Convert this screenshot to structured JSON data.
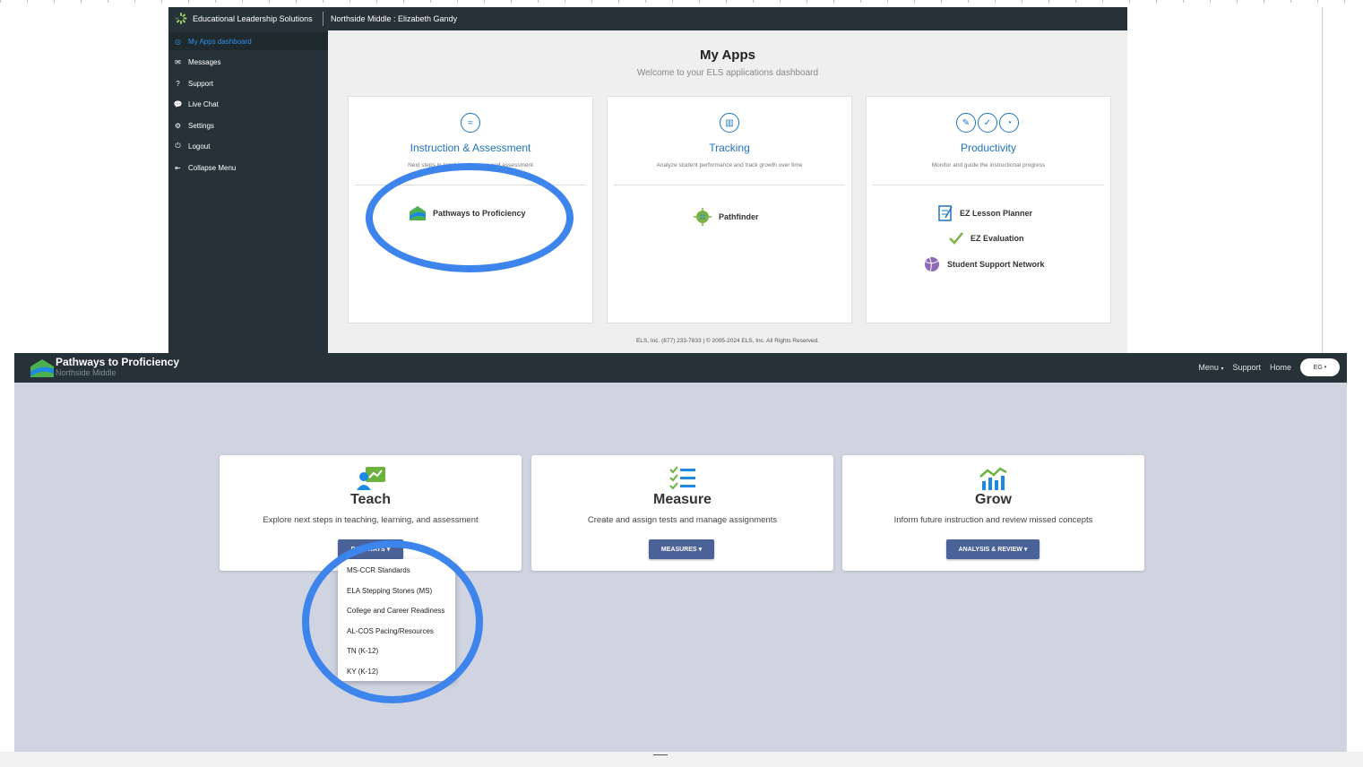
{
  "els": {
    "brand": "Educational Leadership Solutions",
    "school_user": "Northside Middle : Elizabeth Gandy",
    "sidebar": [
      {
        "label": "My Apps dashboard",
        "icon": "dashboard-icon",
        "glyph": "◎"
      },
      {
        "label": "Messages",
        "icon": "envelope-icon",
        "glyph": "✉"
      },
      {
        "label": "Support",
        "icon": "question-icon",
        "glyph": "?"
      },
      {
        "label": "Live Chat",
        "icon": "chat-icon",
        "glyph": "💬"
      },
      {
        "label": "Settings",
        "icon": "gear-icon",
        "glyph": "⚙"
      },
      {
        "label": "Logout",
        "icon": "logout-icon",
        "glyph": "⏻"
      },
      {
        "label": "Collapse Menu",
        "icon": "collapse-icon",
        "glyph": "⇤"
      }
    ],
    "title": "My Apps",
    "subtitle": "Welcome to your ELS applications dashboard",
    "cards": [
      {
        "title": "Instruction & Assessment",
        "desc": "Next steps in teaching, learning and assessment",
        "apps": [
          "Pathways to Proficiency"
        ]
      },
      {
        "title": "Tracking",
        "desc": "Analyze student performance and track growth over time",
        "apps": [
          "Pathfinder"
        ]
      },
      {
        "title": "Productivity",
        "desc": "Monitor and guide the instructional progress",
        "apps": [
          "EZ Lesson Planner",
          "EZ Evaluation",
          "Student Support Network"
        ]
      }
    ],
    "footer": "ELS, Inc. (877) 233-7833 | © 2005-2024 ELS, Inc. All Rights Reserved."
  },
  "ptp": {
    "title": "Pathways to Proficiency",
    "school": "Northside Middle",
    "nav": {
      "menu": "Menu",
      "support": "Support",
      "home": "Home",
      "user": "EG"
    },
    "cards": [
      {
        "title": "Teach",
        "desc": "Explore next steps in teaching, learning, and assessment",
        "button": "PATHWAYS"
      },
      {
        "title": "Measure",
        "desc": "Create and assign tests and manage assignments",
        "button": "MEASURES"
      },
      {
        "title": "Grow",
        "desc": "Inform future instruction and review missed concepts",
        "button": "ANALYSIS & REVIEW"
      }
    ],
    "dropdown": [
      "MS-CCR Standards",
      "ELA Stepping Stones (MS)",
      "College and Career Readiness",
      "AL-COS Pacing/Resources",
      "TN (K-12)",
      "KY (K-12)"
    ]
  },
  "colors": {
    "nav_dark": "#263238",
    "link_blue": "#1e73be",
    "button_blue": "#4a6297",
    "highlight": "#3d84ec",
    "ptp_bg": "#cfd4e0"
  }
}
